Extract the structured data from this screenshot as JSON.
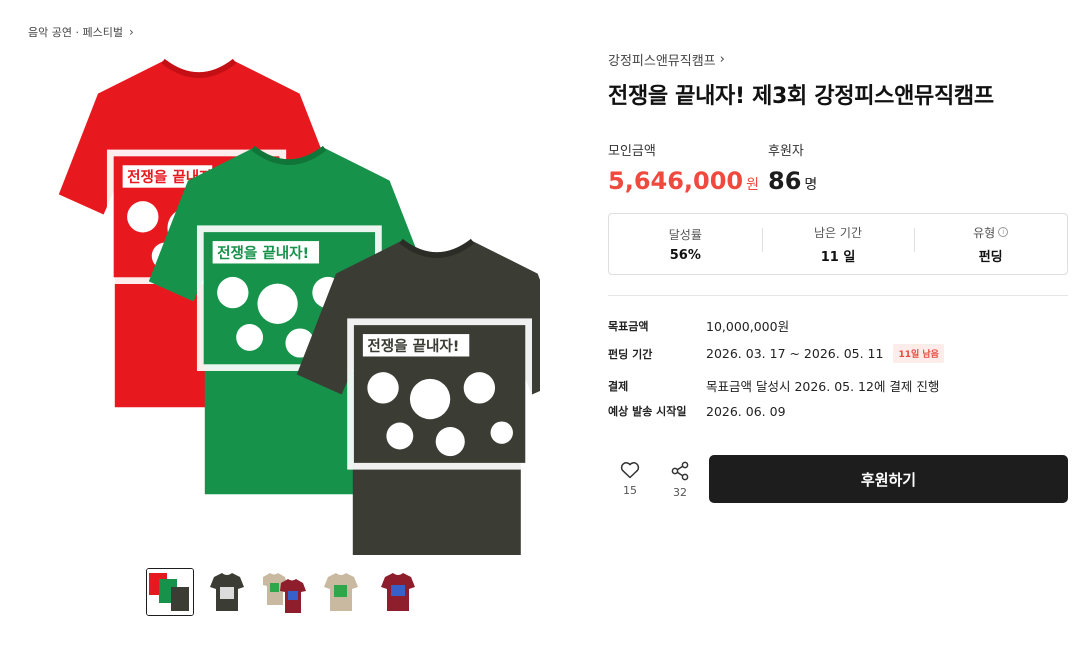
{
  "breadcrumb": {
    "label": "음악 공연 · 페스티벌"
  },
  "project": {
    "creator": "강정피스앤뮤직캠프",
    "title": "전쟁을 끝내자! 제3회 강정피스앤뮤직캠프"
  },
  "stats": {
    "raised_label": "모인금액",
    "raised_value": "5,646,000",
    "raised_unit": "원",
    "backers_label": "후원자",
    "backers_value": "86",
    "backers_unit": "명"
  },
  "info": {
    "achievement_label": "달성률",
    "achievement_value": "56%",
    "remaining_label": "남은 기간",
    "remaining_value": "11 일",
    "type_label": "유형",
    "type_value": "펀딩"
  },
  "details": {
    "goal_label": "목표금액",
    "goal_value": "10,000,000원",
    "period_label": "펀딩 기간",
    "period_value": "2026. 03. 17 ~ 2026. 05. 11",
    "period_badge": "11일 남음",
    "payment_label": "결제",
    "payment_value": "목표금액 달성시 2026. 05. 12에 결제 진행",
    "shipping_label": "예상 발송 시작일",
    "shipping_value": "2026. 06. 09"
  },
  "actions": {
    "like_count": "15",
    "share_count": "32",
    "support_label": "후원하기"
  },
  "shirt_print_text": "전쟁을 끝내자!",
  "colors": {
    "accent_red": "#f0493e",
    "shirt_red": "#e8191e",
    "shirt_green": "#16924a",
    "shirt_charcoal": "#3b3d35",
    "shirt_beige": "#c9b9a0",
    "shirt_maroon": "#8e1e2c",
    "button_dark": "#1d1d1d"
  },
  "icons": [
    "chevron-right-icon",
    "info-icon",
    "heart-icon",
    "share-icon"
  ]
}
